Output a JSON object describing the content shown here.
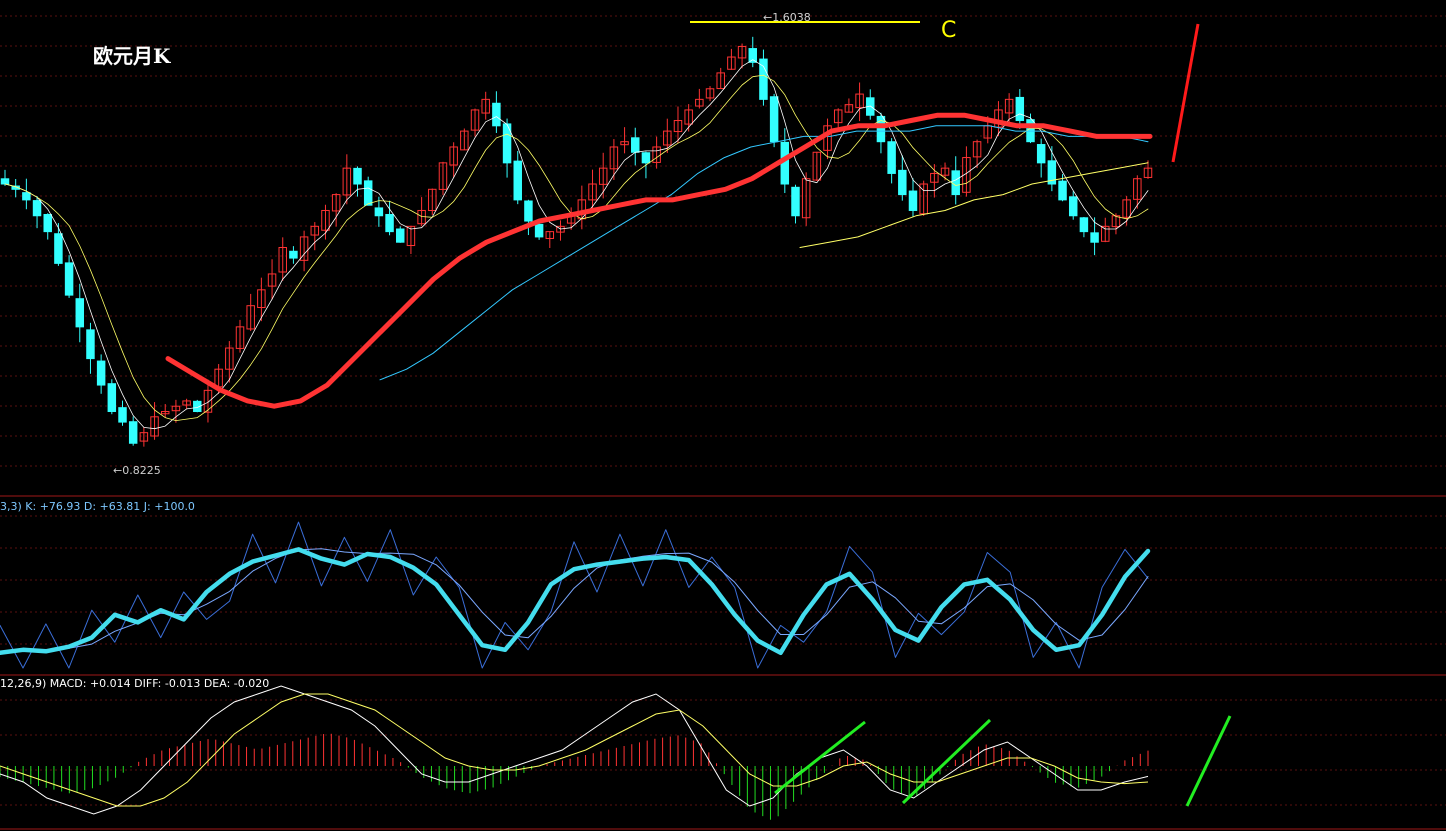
{
  "chart_data": [
    {
      "type": "candlestick",
      "title": "欧元月K",
      "annotations": {
        "high_label": "1.6038",
        "low_label": "0.8225",
        "wave_label": "C"
      },
      "colors": {
        "up": "#ff3333",
        "down": "#33ffff",
        "ma_main": "#ff3333",
        "ma_long": "#33c8ff",
        "ma_short": "#ffffff",
        "ma_mid": "#ffff66",
        "marker": "#ffff00"
      },
      "ylim": [
        0.78,
        1.64
      ],
      "close_path": [
        1.33,
        1.32,
        1.3,
        1.27,
        1.24,
        1.18,
        1.12,
        1.06,
        1.0,
        0.95,
        0.9,
        0.88,
        0.84,
        0.86,
        0.89,
        0.9,
        0.91,
        0.92,
        0.9,
        0.94,
        0.98,
        1.02,
        1.06,
        1.1,
        1.13,
        1.16,
        1.21,
        1.19,
        1.23,
        1.25,
        1.28,
        1.31,
        1.36,
        1.33,
        1.29,
        1.27,
        1.24,
        1.22,
        1.25,
        1.28,
        1.32,
        1.37,
        1.4,
        1.43,
        1.47,
        1.49,
        1.44,
        1.37,
        1.3,
        1.26,
        1.23,
        1.24,
        1.25,
        1.27,
        1.3,
        1.33,
        1.36,
        1.4,
        1.41,
        1.39,
        1.37,
        1.4,
        1.43,
        1.45,
        1.47,
        1.49,
        1.51,
        1.54,
        1.57,
        1.59,
        1.56,
        1.49,
        1.41,
        1.33,
        1.27,
        1.34,
        1.39,
        1.44,
        1.47,
        1.48,
        1.5,
        1.46,
        1.41,
        1.35,
        1.31,
        1.28,
        1.33,
        1.35,
        1.36,
        1.31,
        1.38,
        1.41,
        1.44,
        1.47,
        1.49,
        1.45,
        1.41,
        1.37,
        1.33,
        1.3,
        1.27,
        1.24,
        1.22,
        1.25,
        1.27,
        1.3,
        1.34,
        1.36
      ],
      "x_start_index": 0,
      "ma_main": [
        1.0,
        0.97,
        0.94,
        0.92,
        0.91,
        0.92,
        0.95,
        1.0,
        1.05,
        1.1,
        1.15,
        1.19,
        1.22,
        1.24,
        1.26,
        1.27,
        1.28,
        1.29,
        1.3,
        1.3,
        1.31,
        1.32,
        1.34,
        1.37,
        1.4,
        1.43,
        1.44,
        1.44,
        1.45,
        1.46,
        1.46,
        1.45,
        1.44,
        1.44,
        1.43,
        1.42,
        1.42,
        1.42
      ],
      "ma_long": [
        0.96,
        0.98,
        1.01,
        1.05,
        1.09,
        1.13,
        1.16,
        1.19,
        1.22,
        1.25,
        1.28,
        1.31,
        1.35,
        1.38,
        1.4,
        1.41,
        1.42,
        1.42,
        1.43,
        1.43,
        1.43,
        1.44,
        1.44,
        1.44,
        1.43,
        1.43,
        1.42,
        1.42,
        1.42,
        1.41
      ],
      "ma_mid_low": [
        1.21,
        1.22,
        1.23,
        1.25,
        1.27,
        1.28,
        1.3,
        1.31,
        1.33,
        1.34,
        1.35,
        1.36,
        1.37
      ]
    },
    {
      "type": "line",
      "label": "3,3) K: +76.93 D: +63.81 J: +100.0",
      "series": [
        {
          "name": "K",
          "values": [
            10,
            12,
            11,
            14,
            20,
            35,
            30,
            38,
            32,
            50,
            62,
            70,
            74,
            78,
            72,
            68,
            75,
            73,
            66,
            55,
            35,
            15,
            12,
            30,
            55,
            65,
            68,
            70,
            72,
            73,
            71,
            55,
            35,
            18,
            10,
            35,
            55,
            62,
            45,
            25,
            18,
            40,
            55,
            58,
            45,
            25,
            12,
            15,
            35,
            60,
            77
          ]
        }
      ],
      "ylim": [
        0,
        100
      ]
    },
    {
      "type": "bar",
      "label": "12,26,9) MACD: +0.014 DIFF: -0.013 DEA: -0.020",
      "series": [
        {
          "name": "MACD",
          "values": [
            -0.01,
            -0.015,
            -0.02,
            -0.025,
            -0.02,
            -0.01,
            0.005,
            0.015,
            0.02,
            0.025,
            0.02,
            0.015,
            0.02,
            0.025,
            0.03,
            0.025,
            0.015,
            0.005,
            -0.01,
            -0.02,
            -0.025,
            -0.02,
            -0.01,
            0.0,
            0.005,
            0.01,
            0.015,
            0.02,
            0.025,
            0.028,
            0.02,
            -0.01,
            -0.04,
            -0.05,
            -0.03,
            -0.01,
            0.01,
            0.005,
            -0.02,
            -0.03,
            -0.01,
            0.01,
            0.02,
            0.015,
            0.0,
            -0.015,
            -0.02,
            -0.01,
            0.005,
            0.014
          ]
        },
        {
          "name": "DIFF",
          "values": [
            -0.01,
            -0.02,
            -0.04,
            -0.05,
            -0.06,
            -0.05,
            -0.03,
            0.0,
            0.03,
            0.06,
            0.08,
            0.09,
            0.1,
            0.09,
            0.08,
            0.07,
            0.05,
            0.02,
            -0.01,
            -0.02,
            -0.02,
            -0.01,
            0.0,
            0.01,
            0.02,
            0.04,
            0.06,
            0.08,
            0.09,
            0.07,
            0.02,
            -0.03,
            -0.05,
            -0.04,
            -0.01,
            0.01,
            0.02,
            0.0,
            -0.03,
            -0.04,
            -0.02,
            0.0,
            0.02,
            0.03,
            0.01,
            -0.01,
            -0.03,
            -0.03,
            -0.02,
            -0.013
          ]
        },
        {
          "name": "DEA",
          "values": [
            0.0,
            -0.01,
            -0.02,
            -0.03,
            -0.04,
            -0.05,
            -0.05,
            -0.04,
            -0.02,
            0.01,
            0.04,
            0.06,
            0.08,
            0.09,
            0.09,
            0.08,
            0.07,
            0.05,
            0.03,
            0.01,
            0.0,
            -0.005,
            -0.005,
            0.0,
            0.01,
            0.02,
            0.035,
            0.05,
            0.065,
            0.07,
            0.05,
            0.02,
            -0.01,
            -0.025,
            -0.025,
            -0.015,
            0.0,
            0.005,
            -0.01,
            -0.02,
            -0.02,
            -0.01,
            0.0,
            0.01,
            0.01,
            0.0,
            -0.015,
            -0.02,
            -0.022,
            -0.02
          ]
        }
      ]
    }
  ]
}
